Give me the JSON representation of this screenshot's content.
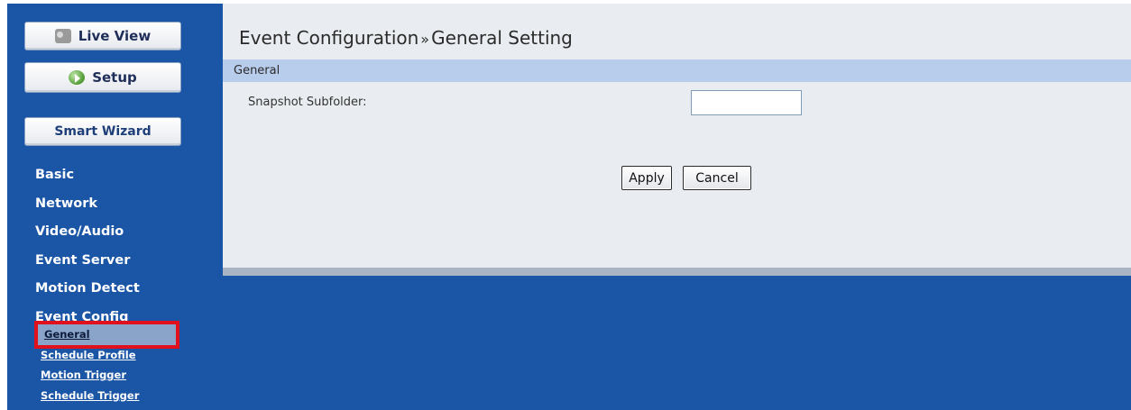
{
  "sidebar": {
    "live_view": "Live View",
    "setup": "Setup",
    "smart_wizard": "Smart Wizard",
    "nav": [
      "Basic",
      "Network",
      "Video/Audio",
      "Event Server",
      "Motion Detect",
      "Event Config"
    ],
    "sub": [
      "General",
      "Schedule Profile",
      "Motion Trigger",
      "Schedule Trigger"
    ],
    "active_sub": "General"
  },
  "page": {
    "title_main": "Event Configuration",
    "title_sep": "»",
    "title_sub": "General Setting"
  },
  "section": {
    "label": "General"
  },
  "form": {
    "snapshot_label": "Snapshot Subfolder:",
    "snapshot_value": ""
  },
  "buttons": {
    "apply": "Apply",
    "cancel": "Cancel"
  },
  "colors": {
    "background_blue": "#1a55a6",
    "section_bar": "#b8ccec",
    "highlight": "#e0101c"
  }
}
